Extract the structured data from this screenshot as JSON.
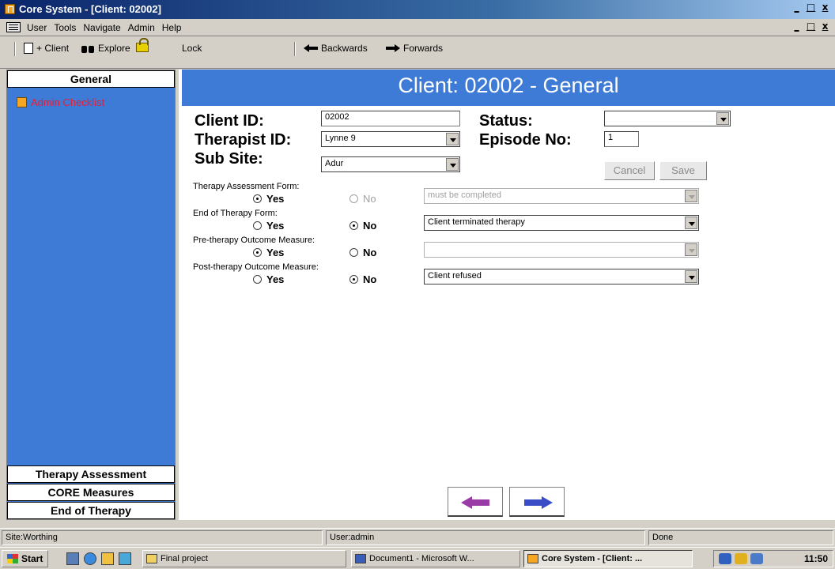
{
  "window": {
    "title": "Core System - [Client: 02002]",
    "min": "_",
    "max": "□",
    "close": "x"
  },
  "menu": {
    "items": [
      "User",
      "Tools",
      "Navigate",
      "Admin",
      "Help"
    ]
  },
  "toolbar": {
    "client_label": "+ Client",
    "explore_label": "Explore",
    "lock_label": "Lock",
    "back_label": "Backwards",
    "forward_label": "Forwards"
  },
  "sidebar": {
    "header": "General",
    "items": [
      {
        "label": "Admin Checklist",
        "icon": "document-icon"
      }
    ],
    "bottom_tabs": [
      "Therapy Assessment",
      "CORE Measures",
      "End of Therapy"
    ]
  },
  "page": {
    "title": "Client: 02002 - General",
    "client_id_label": "Client ID:",
    "client_id_value": "02002",
    "status_label": "Status:",
    "status_value": "",
    "therapist_label": "Therapist ID:",
    "therapist_value": "Lynne 9",
    "episode_label": "Episode No:",
    "episode_value": "1",
    "subsite_label": "Sub Site:",
    "subsite_value": "Adur",
    "cancel": "Cancel",
    "save": "Save",
    "questions": [
      {
        "label": "Therapy Assessment Form:",
        "selected": "Yes",
        "no_disabled": true,
        "detail": "must be completed",
        "detail_disabled": true
      },
      {
        "label": "End of Therapy Form:",
        "selected": "No",
        "no_disabled": false,
        "detail": "Client terminated therapy",
        "detail_disabled": false
      },
      {
        "label": "Pre-therapy Outcome Measure:",
        "selected": "Yes",
        "no_disabled": false,
        "detail": "",
        "detail_disabled": true
      },
      {
        "label": "Post-therapy Outcome Measure:",
        "selected": "No",
        "no_disabled": false,
        "detail": "Client refused",
        "detail_disabled": false
      }
    ],
    "yes_label": "Yes",
    "no_label": "No"
  },
  "statusbar": {
    "site": "Site:Worthing",
    "user": "User:admin",
    "state": "Done"
  },
  "taskbar": {
    "start": "Start",
    "tasks": [
      "Final project",
      "Document1 - Microsoft W...",
      "Core System - [Client: ..."
    ],
    "clock": "11:50"
  },
  "colors": {
    "panel_blue": "#3e7bd6",
    "nav_back": "#9a3aa6",
    "nav_forward": "#3a4cc6"
  }
}
